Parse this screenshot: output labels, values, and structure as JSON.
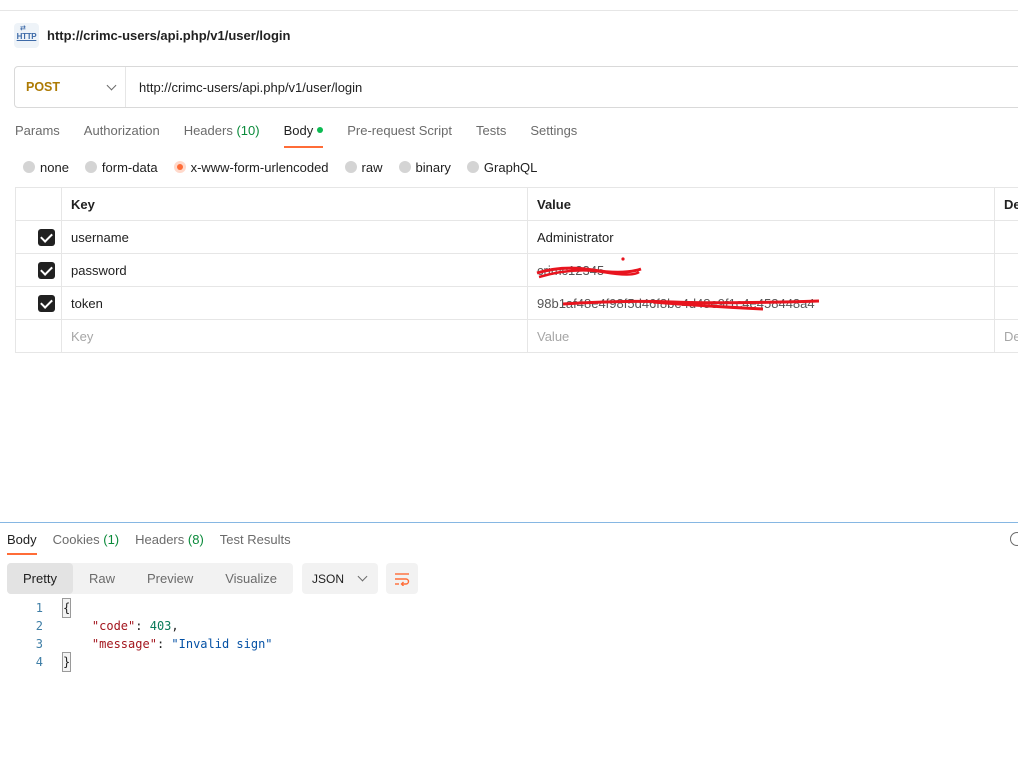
{
  "request": {
    "title": "http://crimc-users/api.php/v1/user/login",
    "icon": "http-request-icon",
    "icon_text": "HTTP",
    "method": "POST",
    "url": "http://crimc-users/api.php/v1/user/login"
  },
  "tabs": {
    "params": "Params",
    "authorization": "Authorization",
    "headers": "Headers",
    "headers_count": "(10)",
    "body": "Body",
    "prerequest": "Pre-request Script",
    "tests": "Tests",
    "settings": "Settings"
  },
  "body_types": {
    "none": "none",
    "form_data": "form-data",
    "urlencoded": "x-www-form-urlencoded",
    "raw": "raw",
    "binary": "binary",
    "graphql": "GraphQL",
    "selected": "x-www-form-urlencoded"
  },
  "table": {
    "headers": {
      "key": "Key",
      "value": "Value",
      "description": "De"
    },
    "rows": [
      {
        "key": "username",
        "value": "Administrator",
        "checked": true
      },
      {
        "key": "password",
        "value": "crimc12345",
        "checked": true,
        "redacted": true
      },
      {
        "key": "token",
        "value": "98b1af48e4f98f5d46f8be4d48e9f1c4e458448a4",
        "checked": true,
        "redacted": true
      }
    ],
    "placeholder": {
      "key": "Key",
      "value": "Value",
      "description": "De"
    }
  },
  "response": {
    "tabs": {
      "body": "Body",
      "cookies": "Cookies",
      "cookies_count": "(1)",
      "headers": "Headers",
      "headers_count": "(8)",
      "test_results": "Test Results"
    },
    "views": {
      "pretty": "Pretty",
      "raw": "Raw",
      "preview": "Preview",
      "visualize": "Visualize"
    },
    "format": "JSON",
    "lines": {
      "n1": "1",
      "n2": "2",
      "n3": "3",
      "n4": "4",
      "open": "{",
      "code_key": "\"code\"",
      "code_val": "403",
      "message_key": "\"message\"",
      "message_val": "\"Invalid sign\"",
      "close": "}"
    }
  },
  "colors": {
    "accent": "#ff6c37",
    "method": "#ad7a03",
    "active_dot": "#0cbb52"
  }
}
